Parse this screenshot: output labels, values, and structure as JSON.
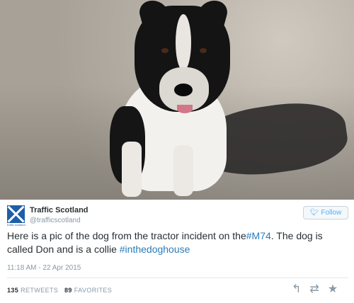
{
  "tweet": {
    "display_name": "Traffic Scotland",
    "handle": "@trafficscotland",
    "follow_label": "Follow",
    "text_before": "Here is a pic of the dog from the tractor incident on the",
    "hashtag_1": "#M74",
    "text_middle": ". The dog is called Don and is a collie ",
    "hashtag_2": "#inthedoghouse",
    "timestamp": "11:18 AM - 22 Apr 2015",
    "retweets_count": "135",
    "retweets_label": "RETWEETS",
    "favorites_count": "89",
    "favorites_label": "FAVORITES",
    "avatar_caption": "traffic scotland"
  },
  "icons": {
    "avatar": "saltire-flag-icon",
    "follow": "twitter-bird-icon",
    "reply": "reply-icon",
    "retweet": "retweet-icon",
    "favorite": "star-icon"
  },
  "colors": {
    "link": "#2b7bb9",
    "twitter_blue": "#55acee",
    "flag_blue": "#1f5ea8",
    "muted": "#8899a6"
  }
}
